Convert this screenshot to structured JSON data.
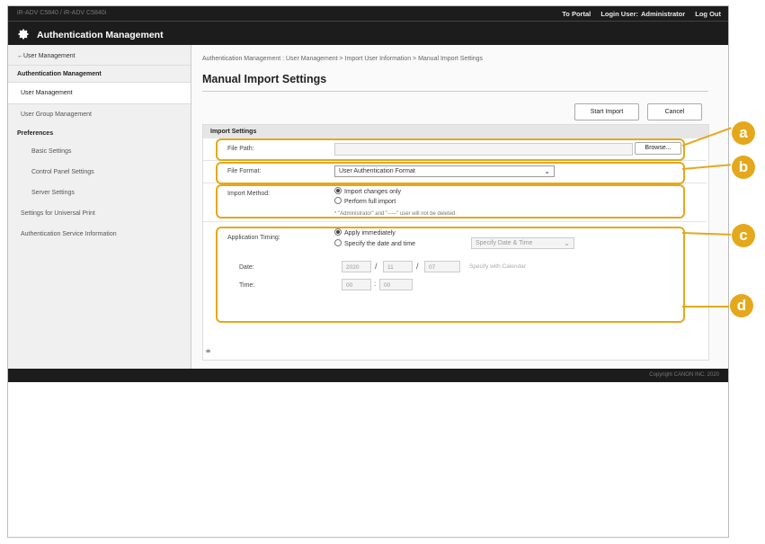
{
  "header": {
    "device_name": "iR-ADV C5840 / iR-ADV C5840i",
    "to_portal": "To Portal",
    "login_user_label": "Login User:",
    "login_user_value": "Administrator",
    "logout": "Log Out",
    "app_title": "Authentication Management"
  },
  "sidebar": {
    "back_link": "←User Management",
    "groups": [
      {
        "label": "Authentication Management"
      },
      {
        "label": "Preferences"
      }
    ],
    "items": [
      {
        "label": "User Management"
      },
      {
        "label": "User Group Management"
      },
      {
        "label": "Basic Settings"
      },
      {
        "label": "Control Panel Settings"
      },
      {
        "label": "Server Settings"
      },
      {
        "label": "Settings for Universal Print"
      },
      {
        "label": "Authentication Service Information"
      }
    ]
  },
  "main": {
    "breadcrumb": "Authentication Management : User Management > Import User Information > Manual Import Settings",
    "page_title": "Manual Import Settings",
    "start_import_button": "Start Import",
    "cancel_button": "Cancel",
    "section_title": "Import Settings",
    "file_path_label": "File Path:",
    "file_path_value": "",
    "browse_button": "Browse...",
    "file_format_label": "File Format:",
    "file_format_value": "User Authentication Format",
    "import_method_label": "Import Method:",
    "import_method_options": [
      "Import changes only",
      "Perform full import"
    ],
    "import_method_note": "* \"Administrator\" and \"-----\" user will not be deleted.",
    "timing_label": "Application Timing:",
    "timing_options": [
      "Apply immediately",
      "Specify the date and time"
    ],
    "timing_select_value": "Specify Date & Time",
    "date_label": "Date:",
    "date_year": "2020",
    "date_month": "11",
    "date_day": "07",
    "date_separator": "/",
    "calendar_link": "Specify with Calendar",
    "time_label": "Time:",
    "time_hour": "00",
    "time_minute": "00",
    "time_separator": ":",
    "collapse_icon": "⩧"
  },
  "footer": {
    "copyright": "Copyright CANON INC. 2020"
  },
  "callouts": [
    "a",
    "b",
    "c",
    "d"
  ],
  "colors": {
    "callout": "#e5a81c",
    "header_bg": "#1c1c1c"
  }
}
